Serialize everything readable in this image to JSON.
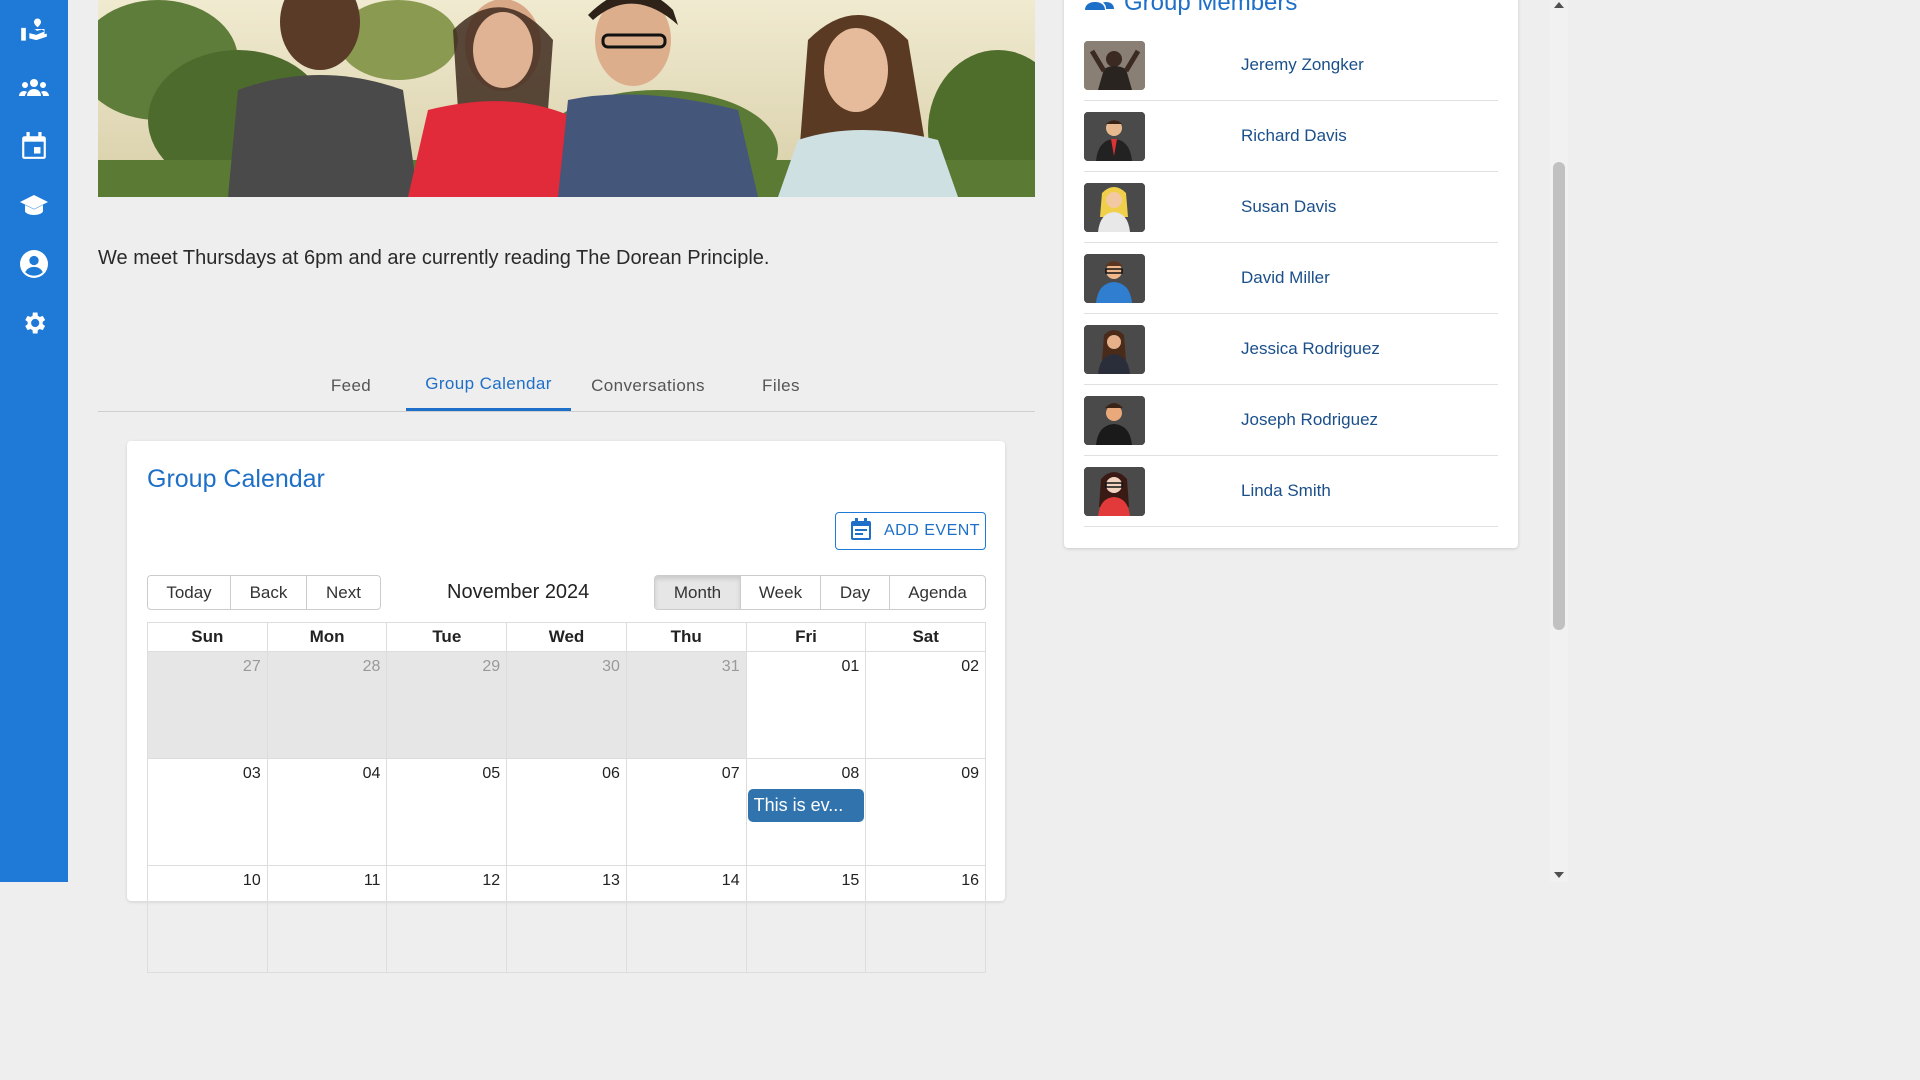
{
  "sidebar": {
    "items": [
      {
        "icon": "hand-heart-icon"
      },
      {
        "icon": "groups-icon"
      },
      {
        "icon": "calendar-icon"
      },
      {
        "icon": "graduation-cap-icon"
      },
      {
        "icon": "account-circle-icon"
      },
      {
        "icon": "settings-gear-icon"
      }
    ]
  },
  "group": {
    "description": "We meet Thursdays at 6pm and are currently reading The Dorean Principle."
  },
  "tabs": [
    {
      "label": "Feed"
    },
    {
      "label": "Group Calendar",
      "active": true
    },
    {
      "label": "Conversations"
    },
    {
      "label": "Files"
    }
  ],
  "calendar": {
    "title": "Group Calendar",
    "add_event_label": "ADD EVENT",
    "nav": [
      "Today",
      "Back",
      "Next"
    ],
    "month_label": "November 2024",
    "views": [
      "Month",
      "Week",
      "Day",
      "Agenda"
    ],
    "active_view": "Month",
    "weekdays": [
      "Sun",
      "Mon",
      "Tue",
      "Wed",
      "Thu",
      "Fri",
      "Sat"
    ],
    "weeks": [
      [
        "27",
        "28",
        "29",
        "30",
        "31",
        "01",
        "02"
      ],
      [
        "03",
        "04",
        "05",
        "06",
        "07",
        "08",
        "09"
      ],
      [
        "10",
        "11",
        "12",
        "13",
        "14",
        "15",
        "16"
      ]
    ],
    "event": {
      "date": "08",
      "title": "This is ev..."
    }
  },
  "members": {
    "title": "Group Members",
    "list": [
      {
        "name": "Jeremy Zongker"
      },
      {
        "name": "Richard Davis"
      },
      {
        "name": "Susan Davis"
      },
      {
        "name": "David Miller"
      },
      {
        "name": "Jessica Rodriguez"
      },
      {
        "name": "Joseph Rodriguez"
      },
      {
        "name": "Linda Smith"
      }
    ]
  },
  "colors": {
    "sidebar": "#1e7ad6",
    "accent": "#1e6fc7",
    "event": "#3174ad"
  }
}
